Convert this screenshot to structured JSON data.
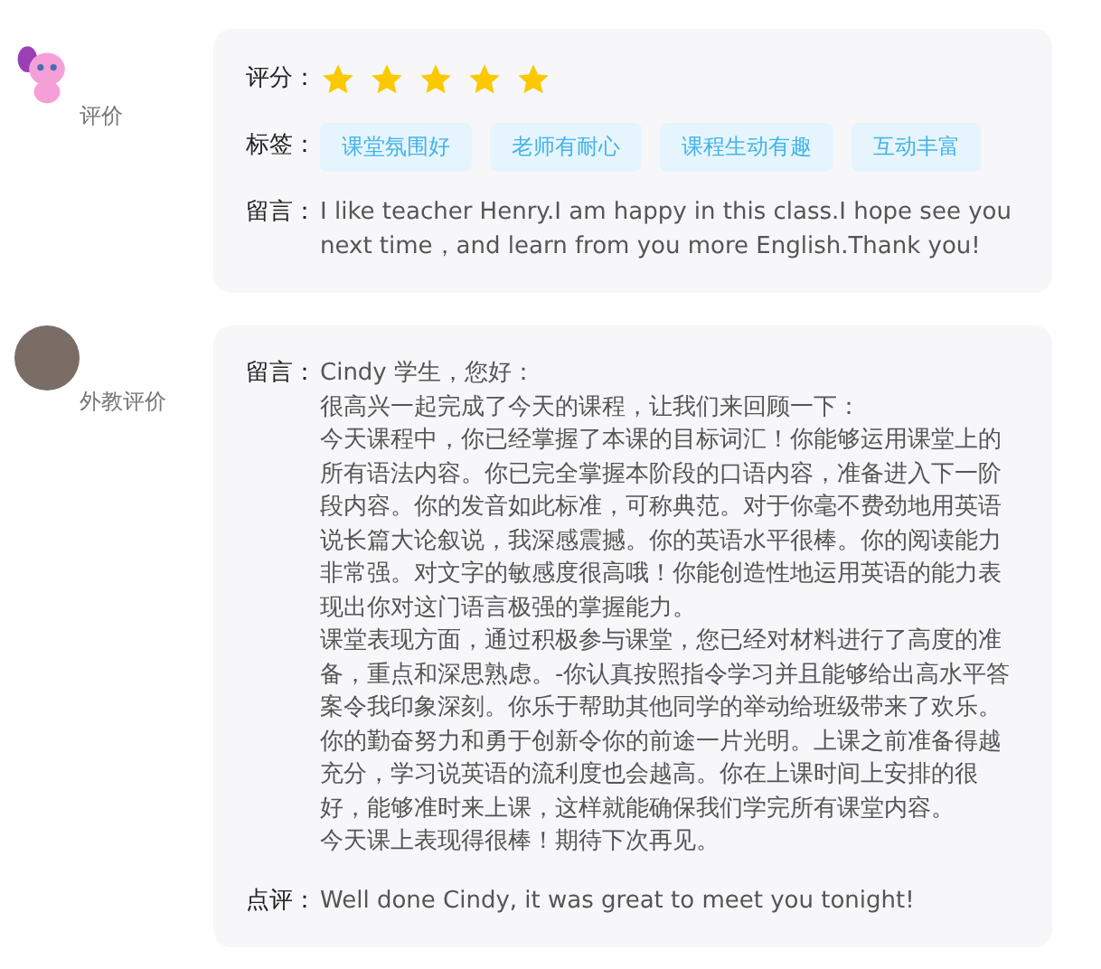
{
  "reviews": [
    {
      "kind": "cartoon",
      "label": "评价",
      "rating": {
        "label": "评分：",
        "stars": 5
      },
      "tags": {
        "label": "标签：",
        "items": [
          "课堂氛围好",
          "老师有耐心",
          "课程生动有趣",
          "互动丰富"
        ]
      },
      "fields": [
        {
          "label": "留言：",
          "paragraphs": [
            "I like teacher Henry.I am happy in this class.I hope see you next time，and learn from you more English.Thank you!"
          ]
        }
      ]
    },
    {
      "kind": "photo",
      "label": "外教评价",
      "fields": [
        {
          "label": "留言：",
          "paragraphs": [
            "Cindy 学生，您好：",
            "很高兴一起完成了今天的课程，让我们来回顾一下：",
            "今天课程中，你已经掌握了本课的目标词汇！你能够运用课堂上的所有语法内容。你已完全掌握本阶段的口语内容，准备进入下一阶段内容。你的发音如此标准，可称典范。对于你毫不费劲地用英语说长篇大论叙说，我深感震撼。你的英语水平很棒。你的阅读能力非常强。对文字的敏感度很高哦！你能创造性地运用英语的能力表现出你对这门语言极强的掌握能力。",
            "课堂表现方面，通过积极参与课堂，您已经对材料进行了高度的准备，重点和深思熟虑。-你认真按照指令学习并且能够给出高水平答案令我印象深刻。你乐于帮助其他同学的举动给班级带来了欢乐。你的勤奋努力和勇于创新令你的前途一片光明。上课之前准备得越充分，学习说英语的流利度也会越高。你在上课时间上安排的很好，能够准时来上课，这样就能确保我们学完所有课堂内容。",
            "今天课上表现得很棒！期待下次再见。"
          ]
        },
        {
          "label": "点评：",
          "paragraphs": [
            "Well done Cindy, it was great to meet you tonight!"
          ]
        }
      ]
    }
  ]
}
